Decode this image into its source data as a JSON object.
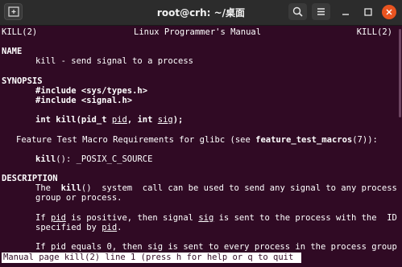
{
  "window": {
    "title": "root@crh: ~/桌面",
    "icons": {
      "new_tab": "new-tab-icon",
      "search": "search-icon",
      "menu": "hamburger-menu-icon",
      "minimize": "minimize-icon",
      "maximize": "maximize-icon",
      "close": "close-icon"
    },
    "colors": {
      "terminal_bg": "#300a24",
      "titlebar_bg": "#2c2c2c",
      "close_accent": "#e95420"
    }
  },
  "man": {
    "header_left": "KILL(2)",
    "header_center": "Linux Programmer's Manual",
    "header_right": "KILL(2)",
    "name_heading": "NAME",
    "name_line": "kill - send signal to a process",
    "synopsis_heading": "SYNOPSIS",
    "include1": "#include <sys/types.h>",
    "include2": "#include <signal.h>",
    "proto_int": "int",
    "proto_kill": "kill",
    "proto_paren": "(pid_t ",
    "proto_pid": "pid",
    "proto_comma": ", int ",
    "proto_sig": "sig",
    "proto_end": ");",
    "ftm_pre": "Feature Test Macro Requirements for glibc (see ",
    "ftm_name": "feature_test_macros",
    "ftm_post": "(7)):",
    "ftm_kill": "kill",
    "ftm_req": "(): _POSIX_C_SOURCE",
    "desc_heading": "DESCRIPTION",
    "d1_pre": "The  ",
    "d1_kill": "kill",
    "d1_post": "()  system  call can be used to send any signal to any process",
    "d2": "group or process.",
    "d3_pre": "If ",
    "d3_pid": "pid",
    "d3_mid": " is positive, then signal ",
    "d3_sig": "sig",
    "d3_post": " is sent to the process with the  ID",
    "d4_pre": "specified by ",
    "d4_pid": "pid",
    "d4_post": ".",
    "d5": "If pid equals 0, then sig is sent to every process in the process group",
    "status_line": "Manual page kill(2) line 1 (press h for help or q to quit)"
  }
}
